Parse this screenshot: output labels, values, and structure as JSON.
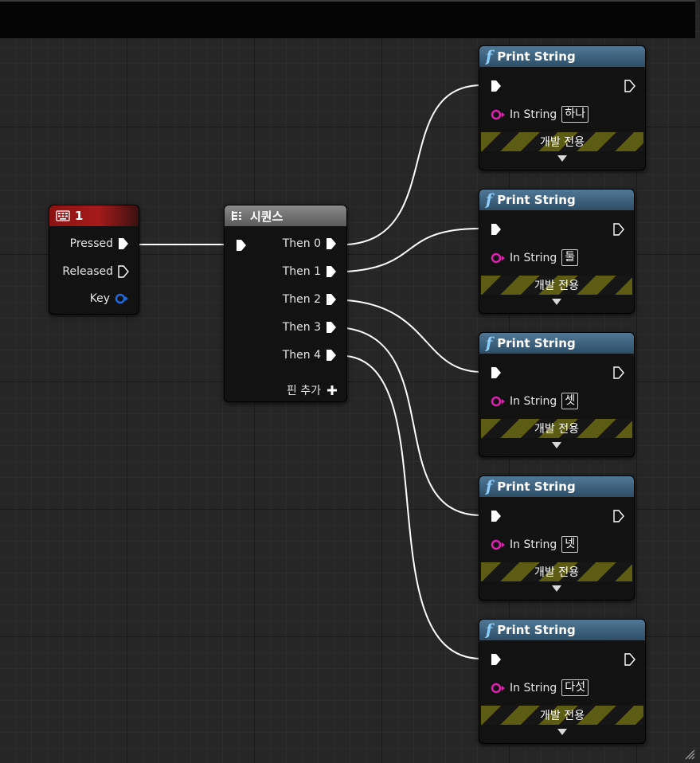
{
  "key_node": {
    "title": "1",
    "icon": "keyboard-icon",
    "pins": {
      "pressed": "Pressed",
      "released": "Released",
      "key": "Key"
    }
  },
  "sequence_node": {
    "title": "시퀀스",
    "icon": "sequence-icon",
    "outputs": [
      "Then 0",
      "Then 1",
      "Then 2",
      "Then 3",
      "Then 4"
    ],
    "add_pin": "핀 추가"
  },
  "print_nodes": [
    {
      "title": "Print String",
      "in_label": "In String",
      "value": "하나",
      "dev": "개발 전용"
    },
    {
      "title": "Print String",
      "in_label": "In String",
      "value": "둘",
      "dev": "개발 전용"
    },
    {
      "title": "Print String",
      "in_label": "In String",
      "value": "셋",
      "dev": "개발 전용"
    },
    {
      "title": "Print String",
      "in_label": "In String",
      "value": "넷",
      "dev": "개발 전용"
    },
    {
      "title": "Print String",
      "in_label": "In String",
      "value": "다섯",
      "dev": "개발 전용"
    }
  ],
  "colors": {
    "exec_wire": "#ffffff",
    "string_pin": "#e020b0",
    "key_pin": "#1a6be0",
    "key_header": "#a51a1a",
    "function_header": "#3f6580"
  }
}
